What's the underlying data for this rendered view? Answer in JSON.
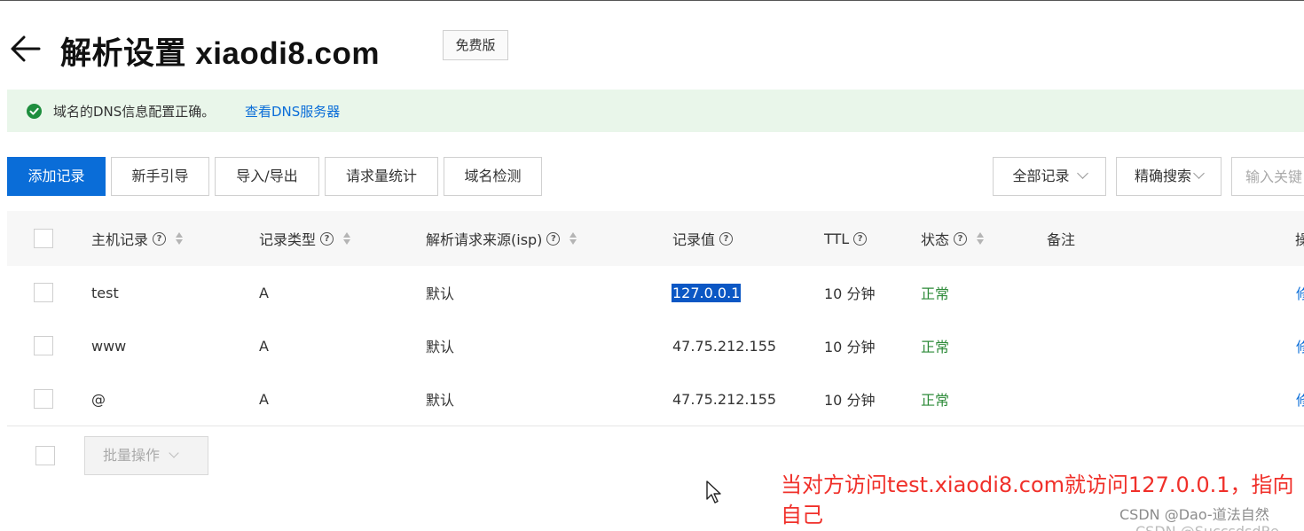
{
  "header": {
    "title": "解析设置 xiaodi8.com",
    "plan_badge": "免费版"
  },
  "notice": {
    "text": "域名的DNS信息配置正确。",
    "link": "查看DNS服务器"
  },
  "toolbar": {
    "add_record": "添加记录",
    "beginner_guide": "新手引导",
    "import_export": "导入/导出",
    "request_stats": "请求量统计",
    "domain_check": "域名检测",
    "all_records": "全部记录",
    "exact_search": "精确搜索",
    "search_placeholder": "输入关键"
  },
  "table": {
    "columns": {
      "host": "主机记录",
      "type": "记录类型",
      "isp": "解析请求来源(isp)",
      "value": "记录值",
      "ttl": "TTL",
      "status": "状态",
      "remark": "备注",
      "action": "操"
    },
    "rows": [
      {
        "host": "test",
        "type": "A",
        "isp": "默认",
        "value": "127.0.0.1",
        "ttl": "10 分钟",
        "status": "正常",
        "action": "修"
      },
      {
        "host": "www",
        "type": "A",
        "isp": "默认",
        "value": "47.75.212.155",
        "ttl": "10 分钟",
        "status": "正常",
        "action": "修"
      },
      {
        "host": "@",
        "type": "A",
        "isp": "默认",
        "value": "47.75.212.155",
        "ttl": "10 分钟",
        "status": "正常",
        "action": "修"
      }
    ]
  },
  "batch": {
    "label": "批量操作"
  },
  "annotation": "当对方访问test.xiaodi8.com就访问127.0.0.1，指向自己",
  "watermark": "CSDN @Dao-道法自然",
  "watermark2": "CSDN @SuccsdsdRe",
  "colors": {
    "primary": "#0a6dd8",
    "notice_bg": "#e9f6ea",
    "status_ok": "#2e8b3a",
    "annotation": "#f0302a"
  }
}
